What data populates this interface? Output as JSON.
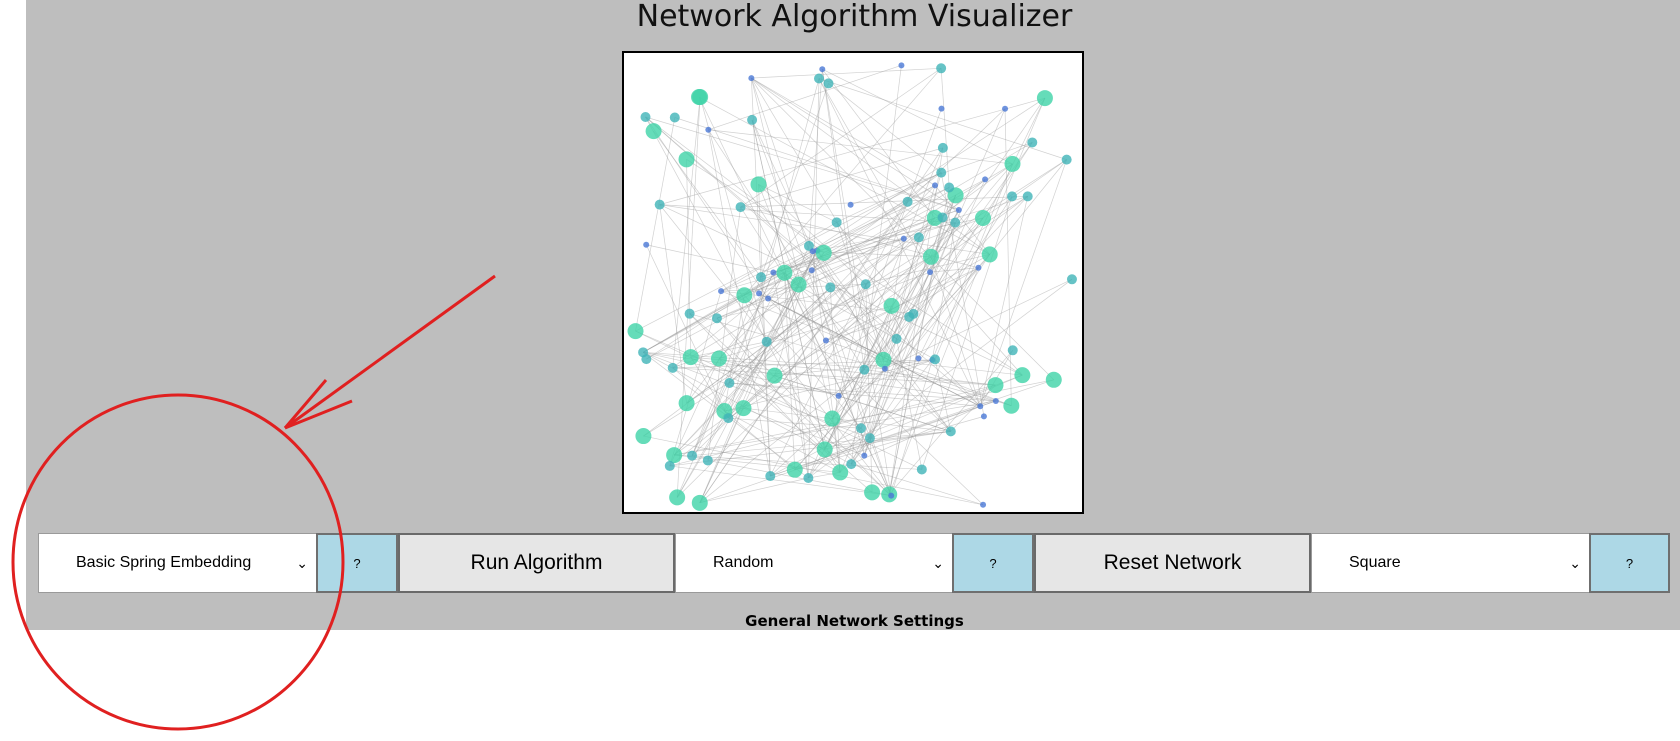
{
  "header": {
    "title": "Network Algorithm Visualizer"
  },
  "controls": {
    "algorithm_select": {
      "value": "Basic Spring Embedding"
    },
    "algorithm_help": "?",
    "run_button": "Run Algorithm",
    "network_type_select": {
      "value": "Random"
    },
    "network_help": "?",
    "reset_button": "Reset Network",
    "shape_select": {
      "value": "Square"
    },
    "shape_help": "?"
  },
  "caption": "General Network Settings",
  "colors": {
    "panel_bg": "#bebebe",
    "node_large": "#3fd3a8",
    "node_medium": "#40b4b8",
    "node_small": "#4a78d6",
    "edge": "#9a9a9a",
    "help_button_bg": "#add8e6",
    "action_button_bg": "#e6e6e6",
    "annotation": "#e02020"
  },
  "icons": {
    "select_chevron": "chevron-down-icon"
  }
}
